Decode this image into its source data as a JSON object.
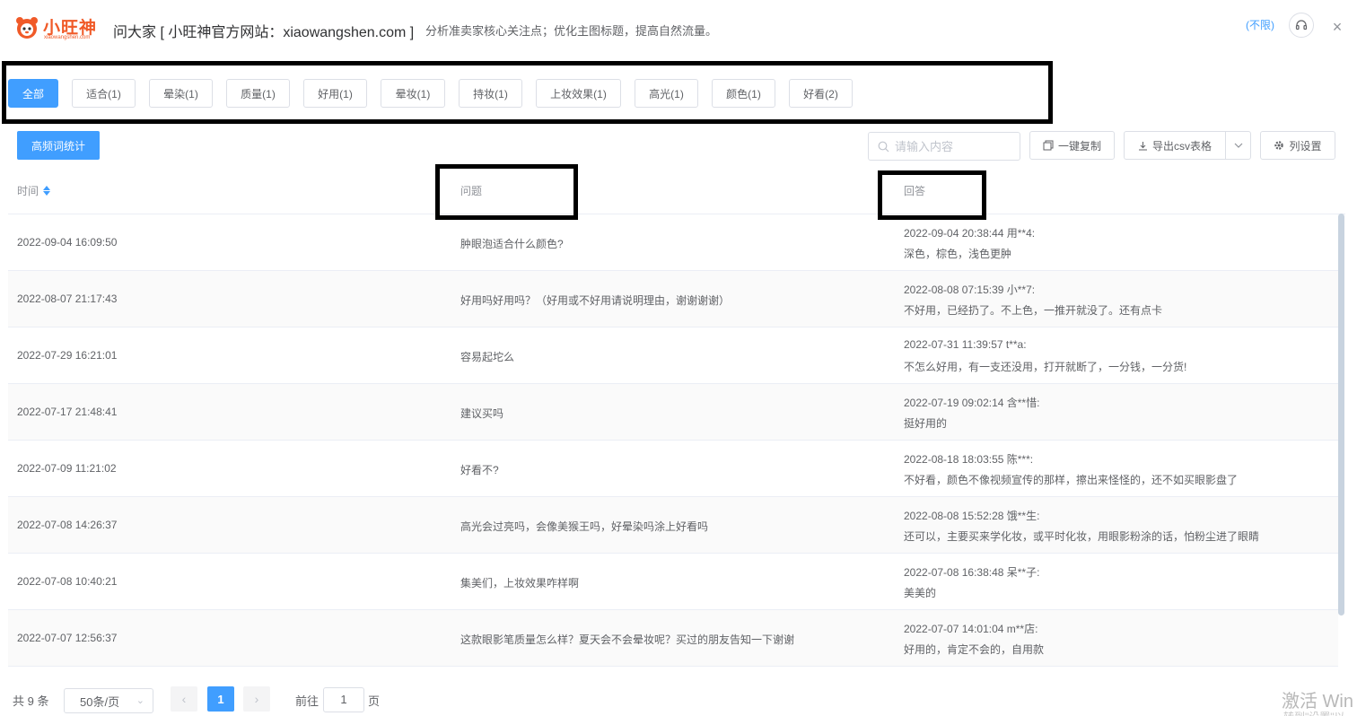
{
  "header": {
    "logo_text": "小旺神",
    "logo_sub": "xiaowangshen.com",
    "title": "问大家 [ 小旺神官方网站：xiaowangshen.com ]",
    "subtitle": "分析准卖家核心关注点；优化主图标题，提高自然流量。",
    "unlimited": "(不限)",
    "close": "×"
  },
  "tabs": [
    {
      "label": "全部",
      "active": true
    },
    {
      "label": "适合(1)"
    },
    {
      "label": "晕染(1)"
    },
    {
      "label": "质量(1)"
    },
    {
      "label": "好用(1)"
    },
    {
      "label": "晕妆(1)"
    },
    {
      "label": "持妆(1)"
    },
    {
      "label": "上妆效果(1)"
    },
    {
      "label": "高光(1)"
    },
    {
      "label": "颜色(1)"
    },
    {
      "label": "好看(2)"
    }
  ],
  "toolbar": {
    "freq_btn": "高频词统计",
    "search_placeholder": "请输入内容",
    "copy_btn": "一键复制",
    "export_btn": "导出csv表格",
    "columns_btn": "列设置"
  },
  "table": {
    "headers": {
      "time": "时间",
      "question": "问题",
      "answer": "回答"
    },
    "rows": [
      {
        "time": "2022-09-04 16:09:50",
        "question": "肿眼泡适合什么颜色?",
        "answer_meta": "2022-09-04 20:38:44  用**4:",
        "answer_text": "深色，棕色，浅色更肿"
      },
      {
        "time": "2022-08-07 21:17:43",
        "question": "好用吗好用吗？（好用或不好用请说明理由，谢谢谢谢）",
        "answer_meta": "2022-08-08 07:15:39  小**7:",
        "answer_text": "不好用，已经扔了。不上色，一推开就没了。还有点卡"
      },
      {
        "time": "2022-07-29 16:21:01",
        "question": "容易起坨么",
        "answer_meta": "2022-07-31 11:39:57  t**a:",
        "answer_text": "不怎么好用，有一支还没用，打开就断了，一分钱，一分货!"
      },
      {
        "time": "2022-07-17 21:48:41",
        "question": "建议买吗",
        "answer_meta": "2022-07-19 09:02:14  含**惜:",
        "answer_text": "挺好用的"
      },
      {
        "time": "2022-07-09 11:21:02",
        "question": "好看不?",
        "answer_meta": "2022-08-18 18:03:55  陈***:",
        "answer_text": "不好看，颜色不像视频宣传的那样，擦出来怪怪的，还不如买眼影盘了"
      },
      {
        "time": "2022-07-08 14:26:37",
        "question": "高光会过亮吗，会像美猴王吗，好晕染吗涂上好看吗",
        "answer_meta": "2022-08-08 15:52:28  饿**生:",
        "answer_text": "还可以，主要买来学化妆，或平时化妆，用眼影粉涂的话，怕粉尘进了眼睛"
      },
      {
        "time": "2022-07-08 10:40:21",
        "question": "集美们，上妆效果咋样啊",
        "answer_meta": "2022-07-08 16:38:48  呆**子:",
        "answer_text": "美美的"
      },
      {
        "time": "2022-07-07 12:56:37",
        "question": "这款眼影笔质量怎么样？夏天会不会晕妆呢？买过的朋友告知一下谢谢",
        "answer_meta": "2022-07-07 14:01:04  m**店:",
        "answer_text": "好用的，肯定不会的，自用款"
      }
    ]
  },
  "pagination": {
    "total": "共 9 条",
    "page_size": "50条/页",
    "current_page": "1",
    "goto_label": "前往",
    "goto_value": "1",
    "goto_suffix": "页"
  },
  "watermark": {
    "text": "激活 Win",
    "sub": "转到\"设置\"以"
  },
  "colors": {
    "primary": "#409eff",
    "brand": "#f05a28",
    "annotation": "#000000"
  }
}
